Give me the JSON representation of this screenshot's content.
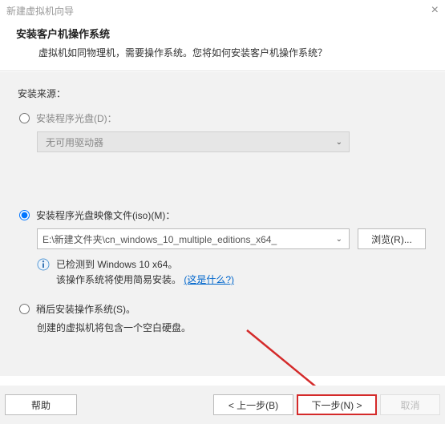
{
  "window": {
    "title": "新建虚拟机向导"
  },
  "header": {
    "title": "安装客户机操作系统",
    "subtitle": "虚拟机如同物理机，需要操作系统。您将如何安装客户机操作系统？"
  },
  "source": {
    "section_label": "安装来源：",
    "disc": {
      "label": "安装程序光盘(D)：",
      "dropdown_value": "无可用驱动器"
    },
    "iso": {
      "label": "安装程序光盘映像文件(iso)(M)：",
      "dropdown_value": "E:\\新建文件夹\\cn_windows_10_multiple_editions_x64_",
      "browse_label": "浏览(R)...",
      "detected_line": "已检测到 Windows 10 x64。",
      "easy_install_line": "该操作系统将使用简易安装。",
      "what_is_this": "(这是什么?)"
    },
    "later": {
      "label": "稍后安装操作系统(S)。",
      "description": "创建的虚拟机将包含一个空白硬盘。"
    }
  },
  "footer": {
    "help": "帮助",
    "back": "< 上一步(B)",
    "next": "下一步(N) >",
    "cancel": "取消"
  }
}
